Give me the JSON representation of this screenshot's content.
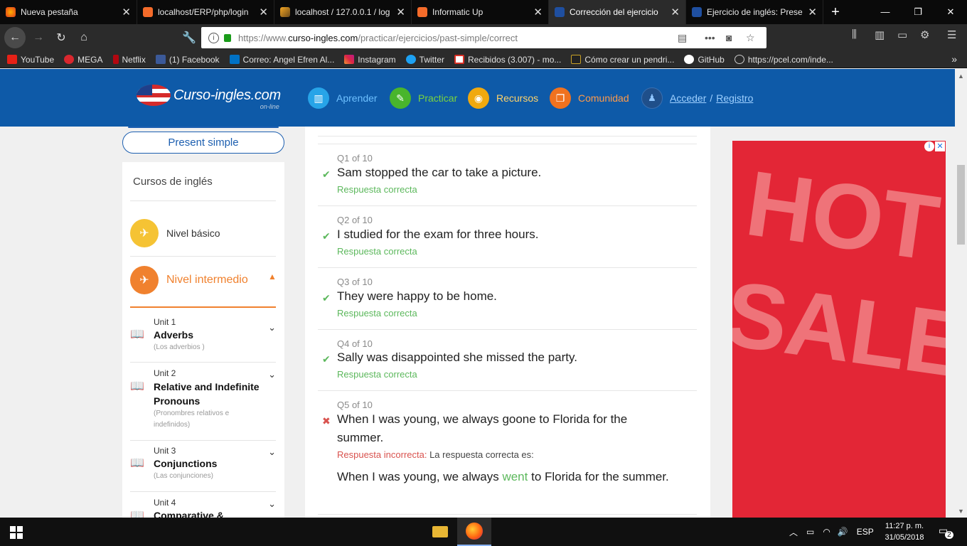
{
  "browser": {
    "tabs": [
      {
        "title": "Nueva pestaña",
        "active": false
      },
      {
        "title": "localhost/ERP/php/login",
        "active": false
      },
      {
        "title": "localhost / 127.0.0.1 / log",
        "active": false
      },
      {
        "title": "Informatic Up",
        "active": false
      },
      {
        "title": "Corrección del ejercicio",
        "active": true
      },
      {
        "title": "Ejercicio de inglés: Prese",
        "active": false
      }
    ],
    "url": {
      "prefix": "https://www.",
      "host": "curso-ingles.com",
      "path": "/practicar/ejercicios/past-simple/correct"
    },
    "bookmarks": [
      "YouTube",
      "MEGA",
      "Netflix",
      "(1) Facebook",
      "Correo: Angel Efren Al...",
      "Instagram",
      "Twitter",
      "Recibidos (3.007) - mo...",
      "Cómo crear un pendri...",
      "GitHub",
      "https://pcel.com/inde..."
    ]
  },
  "site": {
    "logo_text": "Curso-ingles.com",
    "logo_sub": "on-line",
    "nav": {
      "aprender": "Aprender",
      "practicar": "Practicar",
      "recursos": "Recursos",
      "comunidad": "Comunidad",
      "acceder": "Acceder",
      "separator": "/",
      "registro": "Registro"
    }
  },
  "sidebar": {
    "present_button": "Present simple",
    "heading": "Cursos de inglés",
    "level_basic": "Nivel básico",
    "level_intermediate": "Nivel intermedio",
    "units": [
      {
        "num": "Unit 1",
        "name": "Adverbs",
        "sub": "(Los adverbios )"
      },
      {
        "num": "Unit 2",
        "name": "Relative and Indefinite Pronouns",
        "sub": "(Pronombres relativos e indefinidos)"
      },
      {
        "num": "Unit 3",
        "name": "Conjunctions",
        "sub": "(Las conjunciones)"
      },
      {
        "num": "Unit 4",
        "name": "Comparative &",
        "sub": ""
      }
    ]
  },
  "questions": [
    {
      "label": "Q1 of 10",
      "text": "Sam stopped the car to take a picture.",
      "result": "Respuesta correcta",
      "correct": true
    },
    {
      "label": "Q2 of 10",
      "text": "I studied for the exam for three hours.",
      "result": "Respuesta correcta",
      "correct": true
    },
    {
      "label": "Q3 of 10",
      "text": "They were happy to be home.",
      "result": "Respuesta correcta",
      "correct": true
    },
    {
      "label": "Q4 of 10",
      "text": "Sally was disappointed she missed the party.",
      "result": "Respuesta correcta",
      "correct": true
    },
    {
      "label": "Q5 of 10",
      "text": "When I was young, we always goone to Florida for the summer.",
      "result": "Respuesta incorrecta:",
      "result_tail": "La respuesta correcta es:",
      "correct": false,
      "answer_before": "When I was young, we always ",
      "answer_highlight": "went",
      "answer_after": " to Florida for the summer."
    }
  ],
  "ad": {
    "line1": "HOT",
    "line2": "SALE"
  },
  "taskbar": {
    "language": "ESP",
    "time": "11:27 p. m.",
    "date": "31/05/2018",
    "notifications": "2"
  },
  "colors": {
    "brand_blue": "#0e5aa8",
    "correct_green": "#5cb85c",
    "incorrect_red": "#d9534f",
    "intermediate_orange": "#f0812e"
  }
}
